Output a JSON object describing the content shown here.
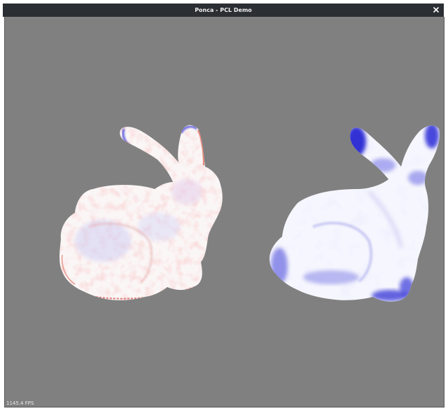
{
  "window": {
    "title": "Ponca - PCL Demo",
    "close_glyph": "×"
  },
  "viewport": {
    "background_color": "#808080",
    "fps_text": "1145.4 FPS"
  },
  "scene": {
    "models": [
      {
        "name": "left-bunny",
        "shading": "curvature-signed",
        "colors": [
          "#ffffff",
          "#e86a5a",
          "#3b3bd6"
        ]
      },
      {
        "name": "right-bunny",
        "shading": "curvature-magnitude",
        "colors": [
          "#ffffff",
          "#2020d0"
        ]
      }
    ]
  },
  "icons": {
    "close": "close-icon"
  }
}
